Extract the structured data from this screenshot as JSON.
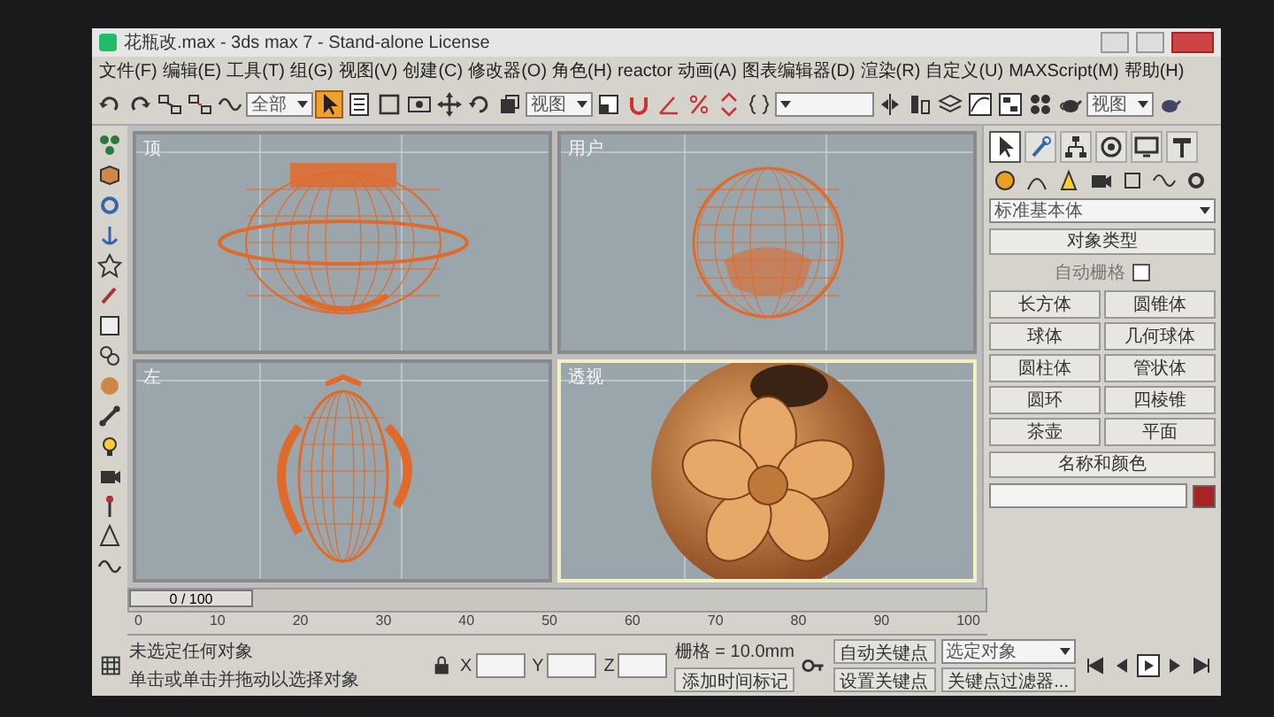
{
  "window": {
    "title": "花瓶改.max - 3ds max 7 - Stand-alone License"
  },
  "menu": [
    "文件(F)",
    "编辑(E)",
    "工具(T)",
    "组(G)",
    "视图(V)",
    "创建(C)",
    "修改器(O)",
    "角色(H)",
    "reactor",
    "动画(A)",
    "图表编辑器(D)",
    "渲染(R)",
    "自定义(U)",
    "MAXScript(M)",
    "帮助(H)"
  ],
  "toolbar": {
    "tools": [
      {
        "kind": "undo",
        "selected": false
      },
      {
        "kind": "redo",
        "selected": false
      },
      {
        "kind": "link",
        "selected": false
      },
      {
        "kind": "unlink",
        "selected": false
      },
      {
        "kind": "bind",
        "selected": false
      },
      {
        "kind": "filter",
        "value": "全部"
      },
      {
        "kind": "select",
        "selected": true
      },
      {
        "kind": "list",
        "selected": false
      },
      {
        "kind": "region",
        "selected": false
      },
      {
        "kind": "window",
        "selected": false
      },
      {
        "kind": "move",
        "selected": false
      },
      {
        "kind": "rotate",
        "selected": false
      },
      {
        "kind": "scale",
        "selected": false
      },
      {
        "kind": "filter",
        "value": "视图"
      },
      {
        "kind": "pivot",
        "selected": false
      },
      {
        "kind": "snap",
        "selected": false
      },
      {
        "kind": "angle",
        "selected": false
      },
      {
        "kind": "percent",
        "selected": false
      },
      {
        "kind": "spinner",
        "selected": false
      },
      {
        "kind": "edit",
        "selected": false
      },
      {
        "kind": "filter"
      },
      {
        "kind": "mirror",
        "selected": false
      },
      {
        "kind": "align",
        "selected": false
      },
      {
        "kind": "layer",
        "selected": false
      },
      {
        "kind": "curve",
        "selected": false
      },
      {
        "kind": "schematic",
        "selected": false
      },
      {
        "kind": "material",
        "selected": false
      },
      {
        "kind": "render",
        "selected": false
      },
      {
        "kind": "filter",
        "value": "视图"
      },
      {
        "kind": "teapot",
        "selected": false
      }
    ]
  },
  "viewports": [
    {
      "label": "顶",
      "kind": "wire-disc",
      "active": false
    },
    {
      "label": "用户",
      "kind": "wire-sphere",
      "active": false
    },
    {
      "label": "左",
      "kind": "wire-egg",
      "active": false
    },
    {
      "label": "透视",
      "kind": "shaded",
      "active": true
    }
  ],
  "command_panel": {
    "tabs": [
      {
        "kind": "create",
        "selected": true
      },
      {
        "kind": "modify",
        "selected": false
      },
      {
        "kind": "hierarchy",
        "selected": false
      },
      {
        "kind": "motion",
        "selected": false
      },
      {
        "kind": "display",
        "selected": false
      },
      {
        "kind": "utilities",
        "selected": false
      }
    ],
    "category": "标准基本体",
    "object_type": "对象类型",
    "autogrid": {
      "label": "自动栅格",
      "checked": false
    },
    "buttons": [
      "长方体",
      "圆锥体",
      "球体",
      "几何球体",
      "圆柱体",
      "管状体",
      "圆环",
      "四棱锥",
      "茶壶",
      "平面"
    ],
    "name_color": "名称和颜色"
  },
  "time_slider": {
    "label": "0 / 100",
    "level": 0
  },
  "ruler": [
    "0",
    "10",
    "20",
    "30",
    "40",
    "50",
    "60",
    "70",
    "80",
    "90",
    "100"
  ],
  "status": {
    "selection": "未选定任何对象",
    "prompt": "单击或单击并拖动以选择对象",
    "coords": [
      "X",
      "Y",
      "Z"
    ],
    "grid": "栅格 = 10.0mm",
    "time_tag": "添加时间标记",
    "autokey": "自动关键点",
    "key_mode": "选定对象",
    "set_key": "设置关键点",
    "key_filters": "关键点过滤器..."
  }
}
